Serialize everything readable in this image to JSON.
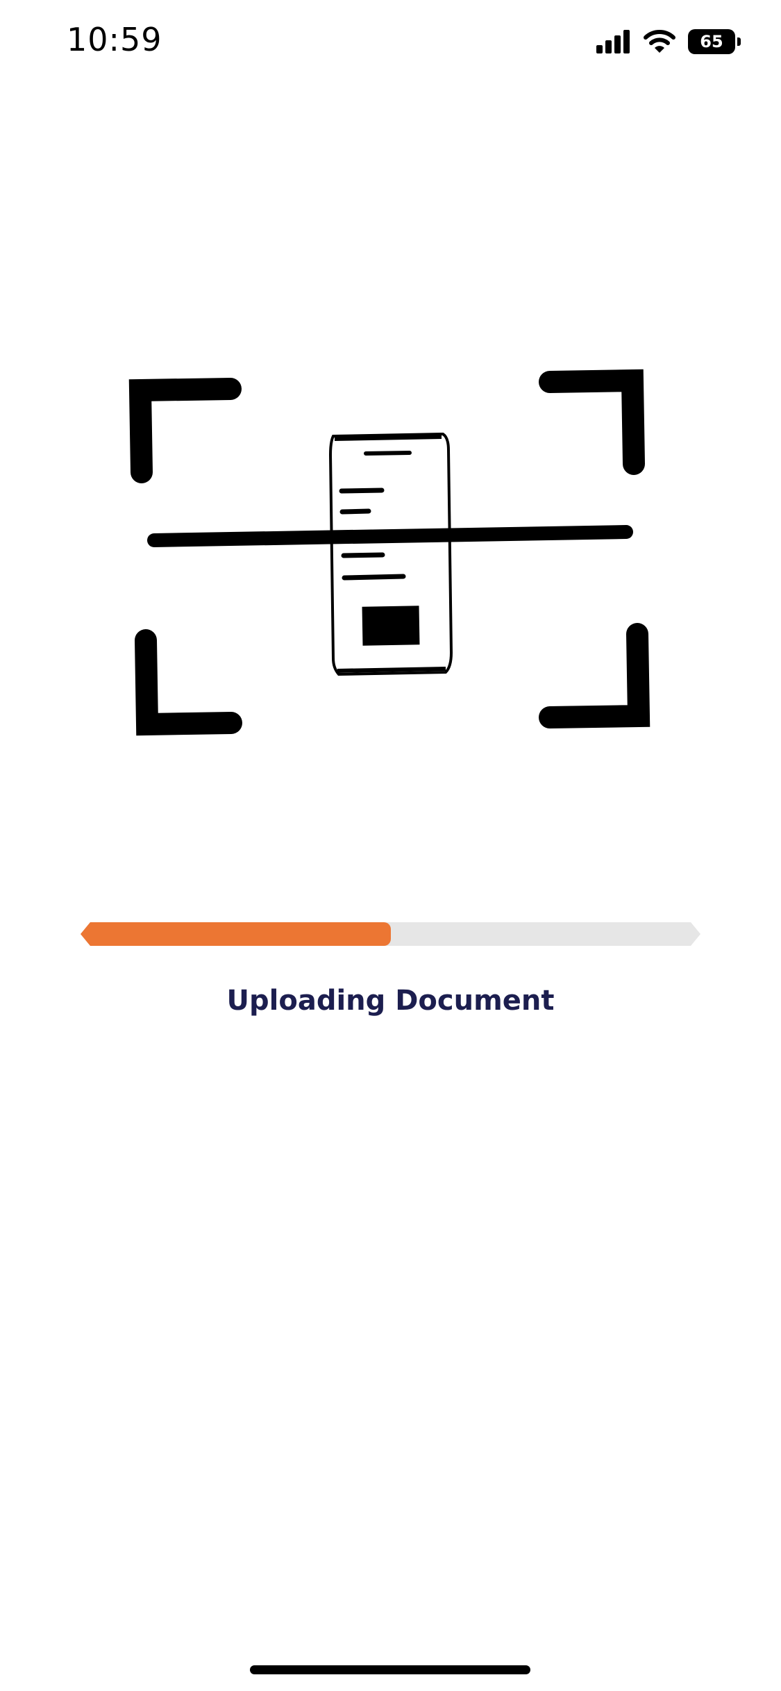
{
  "status_bar": {
    "time": "10:59",
    "battery_level": "65",
    "signal_icon": "cellular-signal-icon",
    "wifi_icon": "wifi-icon"
  },
  "illustration": {
    "icon": "document-scan-icon"
  },
  "upload": {
    "progress_percent": 50,
    "label": "Uploading Document"
  },
  "colors": {
    "progress_fill": "#ec7633",
    "progress_track": "#e6e6e6",
    "label_text": "#1c1e4f"
  }
}
